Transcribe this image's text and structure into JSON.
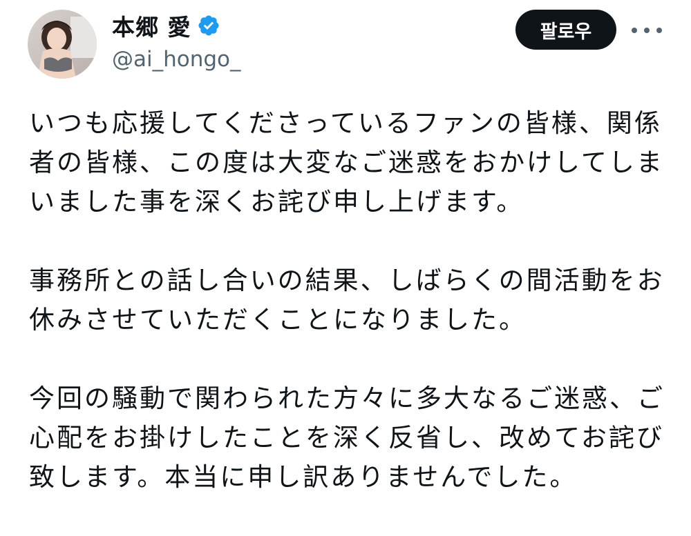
{
  "author": {
    "display_name": "本郷 愛",
    "handle": "@ai_hongo_",
    "verified": true,
    "verified_color": "#1d9bf0"
  },
  "actions": {
    "follow_label": "팔로우",
    "more_icon": "more-horizontal-icon"
  },
  "tweet": {
    "paragraphs": [
      {
        "lines": [
          "いつも応援してくださっているファンの皆様、関係",
          "者の皆様、この度は大変なご迷惑をおかけしてしま",
          "いました事を深くお詫び申し上げます。"
        ]
      },
      {
        "lines": [
          "事務所との話し合いの結果、しばらくの間活動をお",
          "休みさせていただくことになりました。"
        ]
      },
      {
        "lines": [
          "今回の騒動で関わられた方々に多大なるご迷惑、ご",
          "心配をお掛けしたことを深く反省し、改めてお詫び",
          "致します。本当に申し訳ありませんでした。"
        ]
      }
    ]
  },
  "colors": {
    "text_primary": "#0f1419",
    "text_secondary": "#536471",
    "follow_bg": "#0f1419",
    "follow_text": "#ffffff"
  }
}
